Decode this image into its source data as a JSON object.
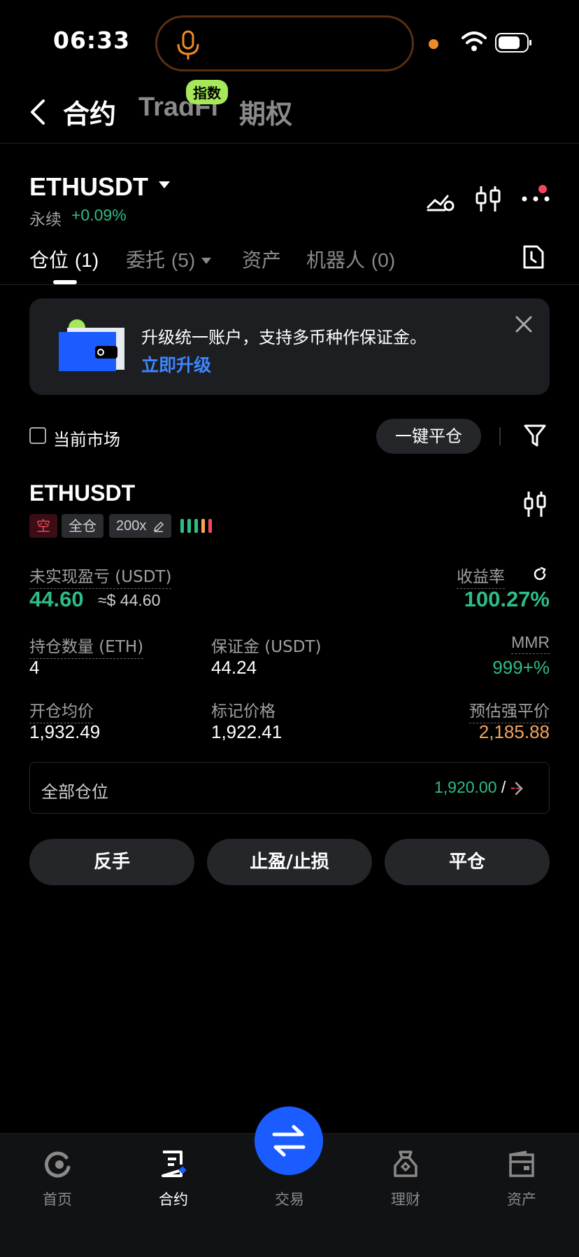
{
  "status_bar": {
    "time": "06:33"
  },
  "nav": {
    "tabs": [
      {
        "label": "合约"
      },
      {
        "label": "TradFi",
        "badge": "指数"
      },
      {
        "label": "期权"
      }
    ]
  },
  "header": {
    "symbol": "ETHUSDT",
    "type": "永续",
    "change": "+0.09%"
  },
  "tabs": [
    {
      "label": "仓位",
      "count": "(1)"
    },
    {
      "label": "委托",
      "count": "(5)"
    },
    {
      "label": "资产"
    },
    {
      "label": "机器人",
      "count": "(0)"
    }
  ],
  "banner": {
    "text": "升级统一账户，支持多币种作保证金。",
    "link": "立即升级"
  },
  "filter": {
    "checkbox_label": "当前市场",
    "close_all": "一键平仓"
  },
  "position": {
    "symbol": "ETHUSDT",
    "side": "空",
    "margin_mode": "全仓",
    "leverage": "200x",
    "pnl_label": "未实现盈亏 (USDT)",
    "pnl": "44.60",
    "pnl_usd": "≈$ 44.60",
    "roe_label": "收益率",
    "roe": "100.27%",
    "size_label": "持仓数量 (ETH)",
    "size": "4",
    "margin_label": "保证金 (USDT)",
    "margin": "44.24",
    "mmr_label": "MMR",
    "mmr": "999+%",
    "entry_label": "开仓均价",
    "entry": "1,932.49",
    "mark_label": "标记价格",
    "mark": "1,922.41",
    "liq_label": "预估强平价",
    "liq": "2,185.88",
    "all_label": "全部仓位",
    "all_tp": "1,920.00",
    "all_sep": "/",
    "all_sl": "--"
  },
  "actions": {
    "reverse": "反手",
    "tpsl": "止盈/止损",
    "close": "平仓"
  },
  "bottom_nav": [
    {
      "label": "首页",
      "icon": "home-icon"
    },
    {
      "label": "合约",
      "icon": "contract-icon"
    },
    {
      "label": "交易",
      "icon": "swap-icon"
    },
    {
      "label": "理财",
      "icon": "earn-icon"
    },
    {
      "label": "资产",
      "icon": "wallet-icon"
    }
  ],
  "colors": {
    "green": "#2ebd85",
    "red": "#f6465d",
    "orange": "#f7a35c",
    "blue": "#1a5cff",
    "badge": "#a6e85a"
  }
}
